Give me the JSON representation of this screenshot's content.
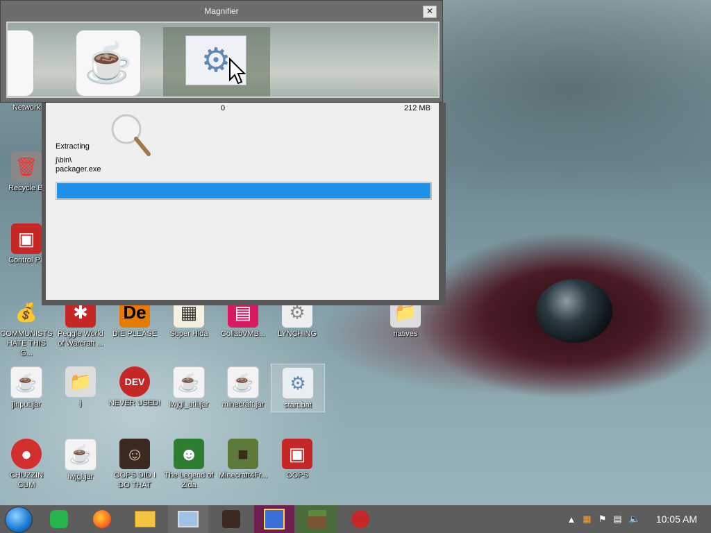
{
  "magnifier": {
    "title": "Magnifier",
    "close_glyph": "✕"
  },
  "extract_dialog": {
    "size_start": "0",
    "size_end": "212 MB",
    "status": "Extracting",
    "path_line1": "j\\bin\\",
    "path_line2": "packager.exe",
    "progress_fraction": 1.0
  },
  "desktop": {
    "icons": [
      {
        "label": "Network"
      },
      {
        "label": "Recycle Bi"
      },
      {
        "label": "Control Pa"
      },
      {
        "label": "COMMUNISTS HATE THIS G..."
      },
      {
        "label": "Peggle World of Warcraft ..."
      },
      {
        "label": "DIE PLEASE"
      },
      {
        "label": "Super Hlda"
      },
      {
        "label": "CollabVMB..."
      },
      {
        "label": "LYNCHING"
      },
      {
        "label": "natives"
      },
      {
        "label": "jinput.jar"
      },
      {
        "label": "j"
      },
      {
        "label": "NEVER USED!"
      },
      {
        "label": "lwjgl_util.jar"
      },
      {
        "label": "minecraft.jar"
      },
      {
        "label": "start.bat"
      },
      {
        "label": "CHUZZIN CUM"
      },
      {
        "label": "lwjgl.jar"
      },
      {
        "label": "OOPS DID I DO THAT"
      },
      {
        "label": "The Legend of Zlda"
      },
      {
        "label": "Minecraft4Fr..."
      },
      {
        "label": "OOPS"
      }
    ]
  },
  "taskbar": {
    "clock": "10:05 AM"
  }
}
